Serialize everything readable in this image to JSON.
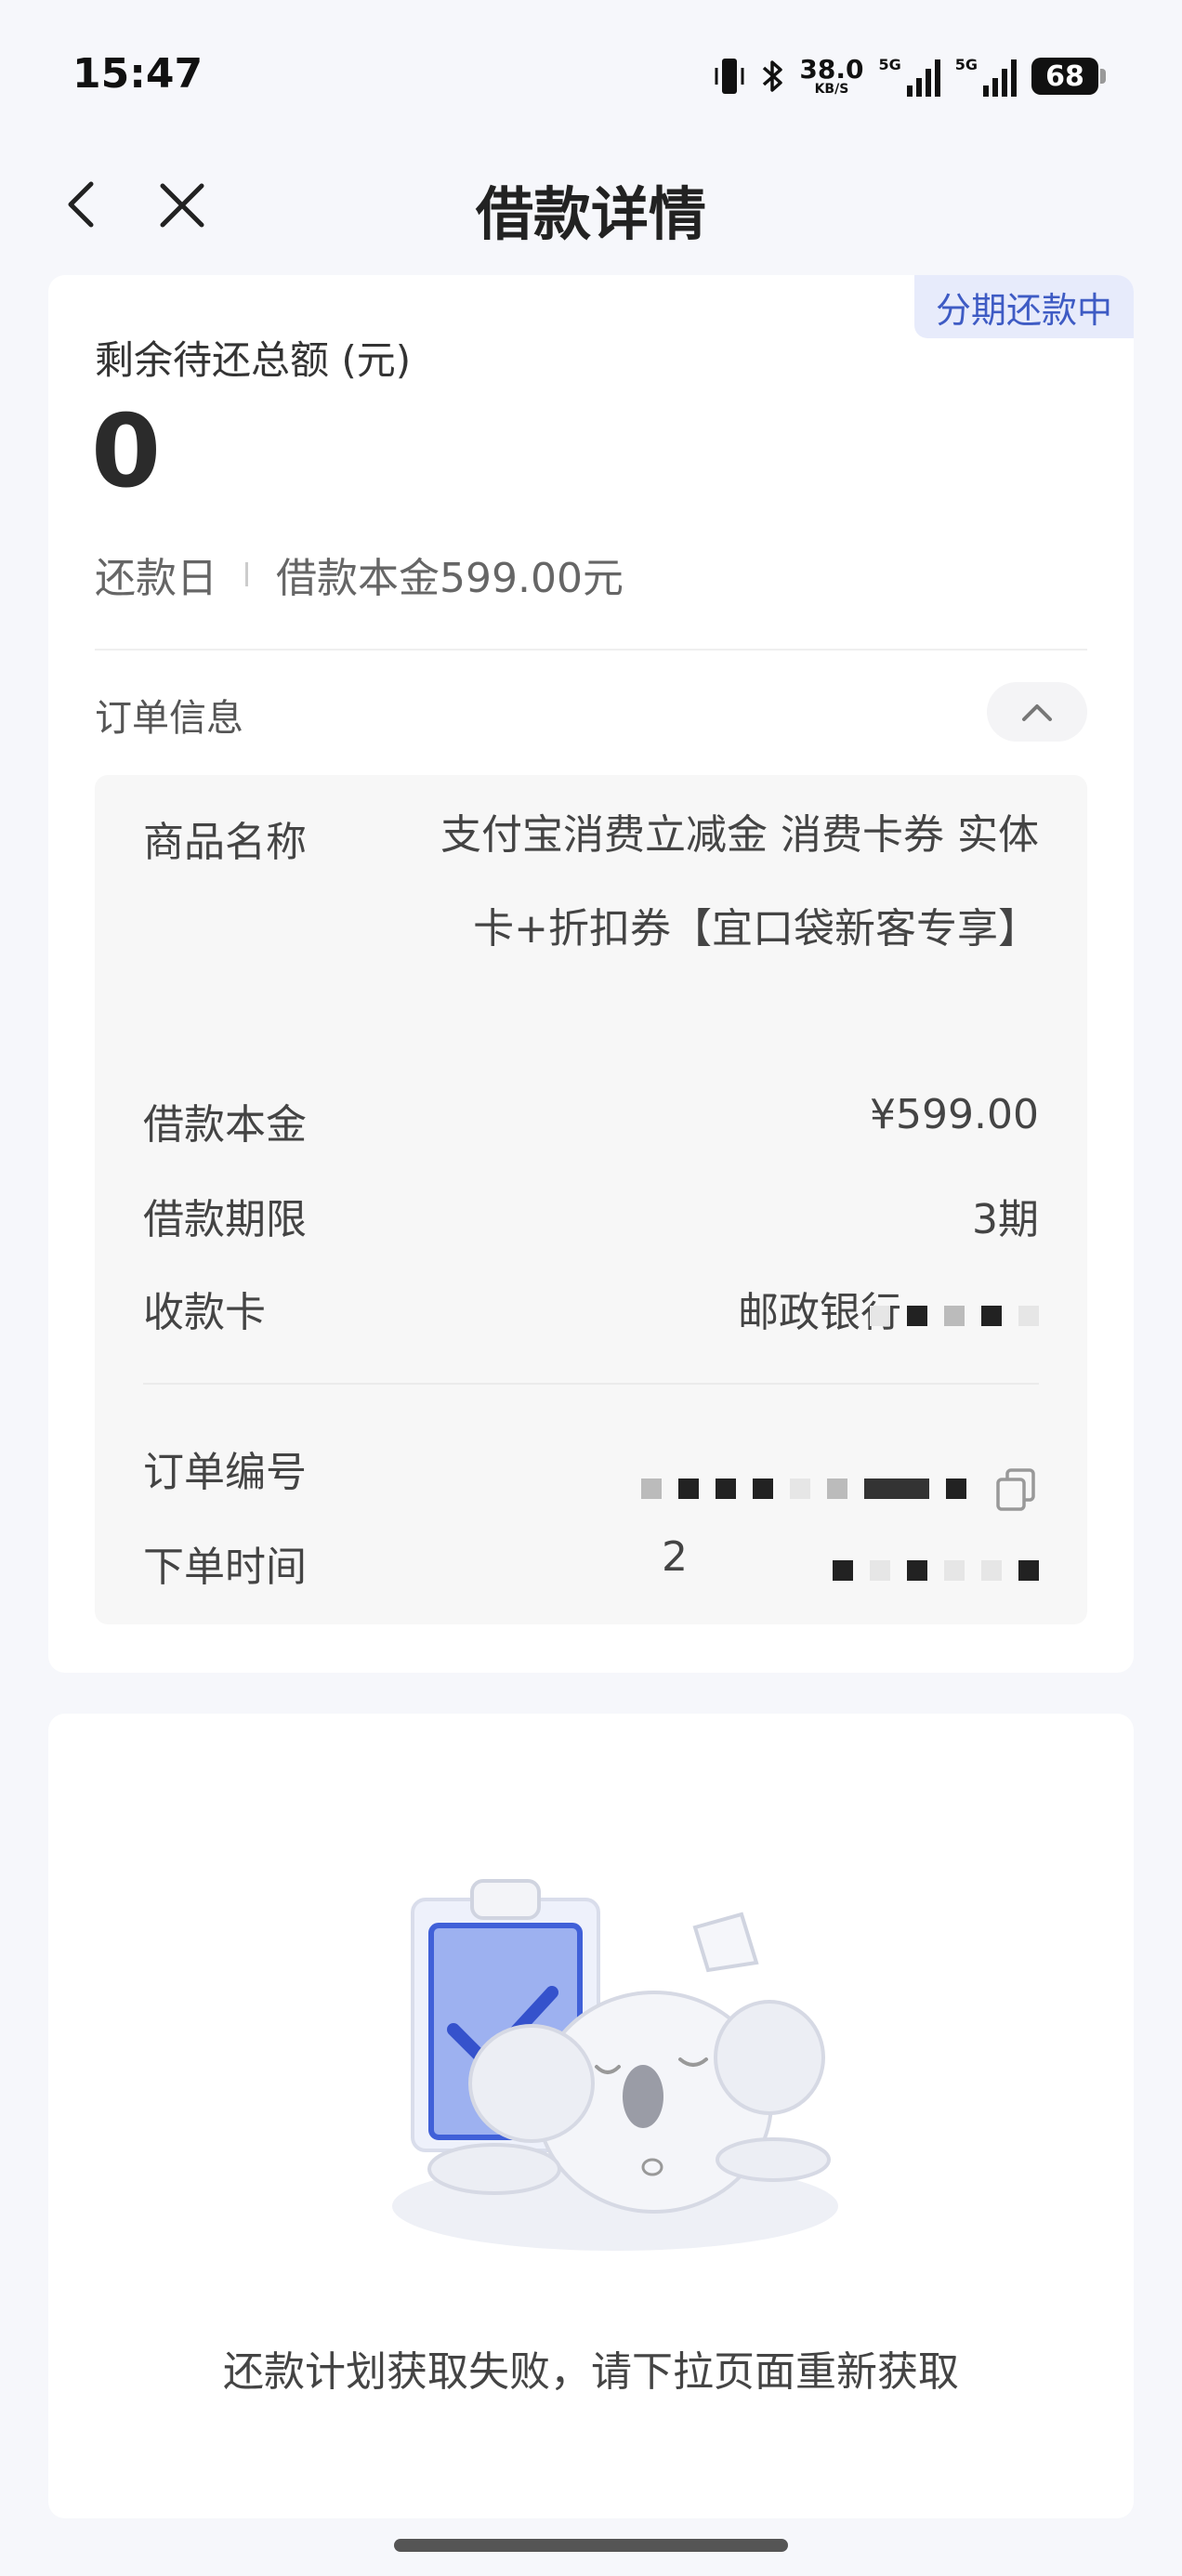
{
  "status_bar": {
    "time": "15:47",
    "net_speed_value": "38.0",
    "net_speed_unit": "KB/S",
    "signal_label_1": "5G",
    "signal_label_2": "5G",
    "battery": "68"
  },
  "nav": {
    "title": "借款详情"
  },
  "summary": {
    "badge": "分期还款中",
    "total_label": "剩余待还总额 (元)",
    "total_value": "0",
    "due_label": "还款日",
    "principal_line": "借款本金599.00元"
  },
  "order_info": {
    "section_label": "订单信息",
    "product_label": "商品名称",
    "product_value": "支付宝消费立减金 消费卡券 实体卡+折扣券【宜口袋新客专享】",
    "principal_label": "借款本金",
    "principal_value": "¥599.00",
    "term_label": "借款期限",
    "term_value": "3期",
    "card_label": "收款卡",
    "card_value": "邮政银行",
    "order_no_label": "订单编号",
    "order_time_label": "下单时间",
    "order_time_partial": "2"
  },
  "plan": {
    "fail_text": "还款计划获取失败，请下拉页面重新获取"
  },
  "colors": {
    "accent": "#3e5bc4",
    "badge_bg": "#e7ebfb",
    "page_bg": "#f6f7fb"
  },
  "icons": [
    "back-icon",
    "close-icon",
    "chevron-up-icon",
    "copy-icon",
    "bluetooth-icon",
    "vibrate-icon"
  ]
}
